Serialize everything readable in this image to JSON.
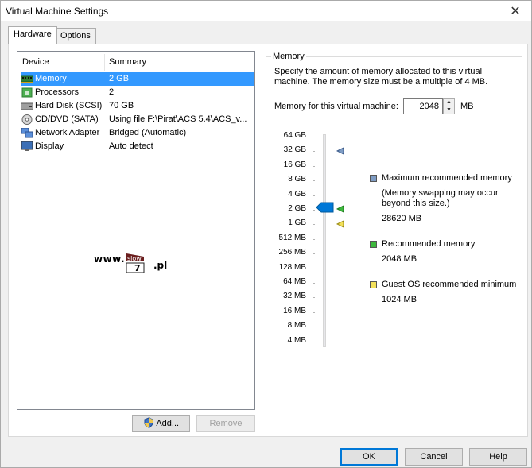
{
  "window": {
    "title": "Virtual Machine Settings",
    "close_glyph": "✕"
  },
  "tabs": [
    {
      "label": "Hardware"
    },
    {
      "label": "Options"
    }
  ],
  "device_table": {
    "headers": {
      "device": "Device",
      "summary": "Summary"
    },
    "rows": [
      {
        "device": "Memory",
        "summary": "2 GB",
        "icon": "memory-icon"
      },
      {
        "device": "Processors",
        "summary": "2",
        "icon": "processor-icon"
      },
      {
        "device": "Hard Disk (SCSI)",
        "summary": "70 GB",
        "icon": "hard-disk-icon"
      },
      {
        "device": "CD/DVD (SATA)",
        "summary": "Using file F:\\Pirat\\ACS 5.4\\ACS_v...",
        "icon": "cd-dvd-icon"
      },
      {
        "device": "Network Adapter",
        "summary": "Bridged (Automatic)",
        "icon": "network-adapter-icon"
      },
      {
        "device": "Display",
        "summary": "Auto detect",
        "icon": "display-icon"
      }
    ]
  },
  "watermark": {
    "prefix": "www.",
    "box_top": "slow",
    "box_bottom": "7",
    "suffix": ".pl"
  },
  "buttons": {
    "add": "Add...",
    "remove": "Remove",
    "ok": "OK",
    "cancel": "Cancel",
    "help": "Help"
  },
  "memory": {
    "group_title": "Memory",
    "description": "Specify the amount of memory allocated to this virtual machine. The memory size must be a multiple of 4 MB.",
    "field_label": "Memory for this virtual machine:",
    "value": "2048",
    "unit": "MB",
    "scale_labels": [
      "64 GB",
      "32 GB",
      "16 GB",
      "8 GB",
      "4 GB",
      "2 GB",
      "1 GB",
      "512 MB",
      "256 MB",
      "128 MB",
      "64 MB",
      "32 MB",
      "16 MB",
      "8 MB",
      "4 MB"
    ],
    "slider_level_label": "2 GB",
    "markers": {
      "maximum": "32 GB",
      "recommended": "2 GB",
      "guest_min": "1 GB"
    },
    "legend": {
      "maximum": {
        "title": "Maximum recommended memory",
        "note": "(Memory swapping may occur beyond this size.)",
        "value": "28620 MB",
        "color": "#7e9cc4"
      },
      "recommended": {
        "title": "Recommended memory",
        "value": "2048 MB",
        "color": "#3cb83c"
      },
      "guest_min": {
        "title": "Guest OS recommended minimum",
        "value": "1024 MB",
        "color": "#f2e05a"
      }
    }
  },
  "colors": {
    "selection": "#3399ff",
    "slider_thumb": "#0078d7",
    "ok_border": "#0078d7"
  }
}
